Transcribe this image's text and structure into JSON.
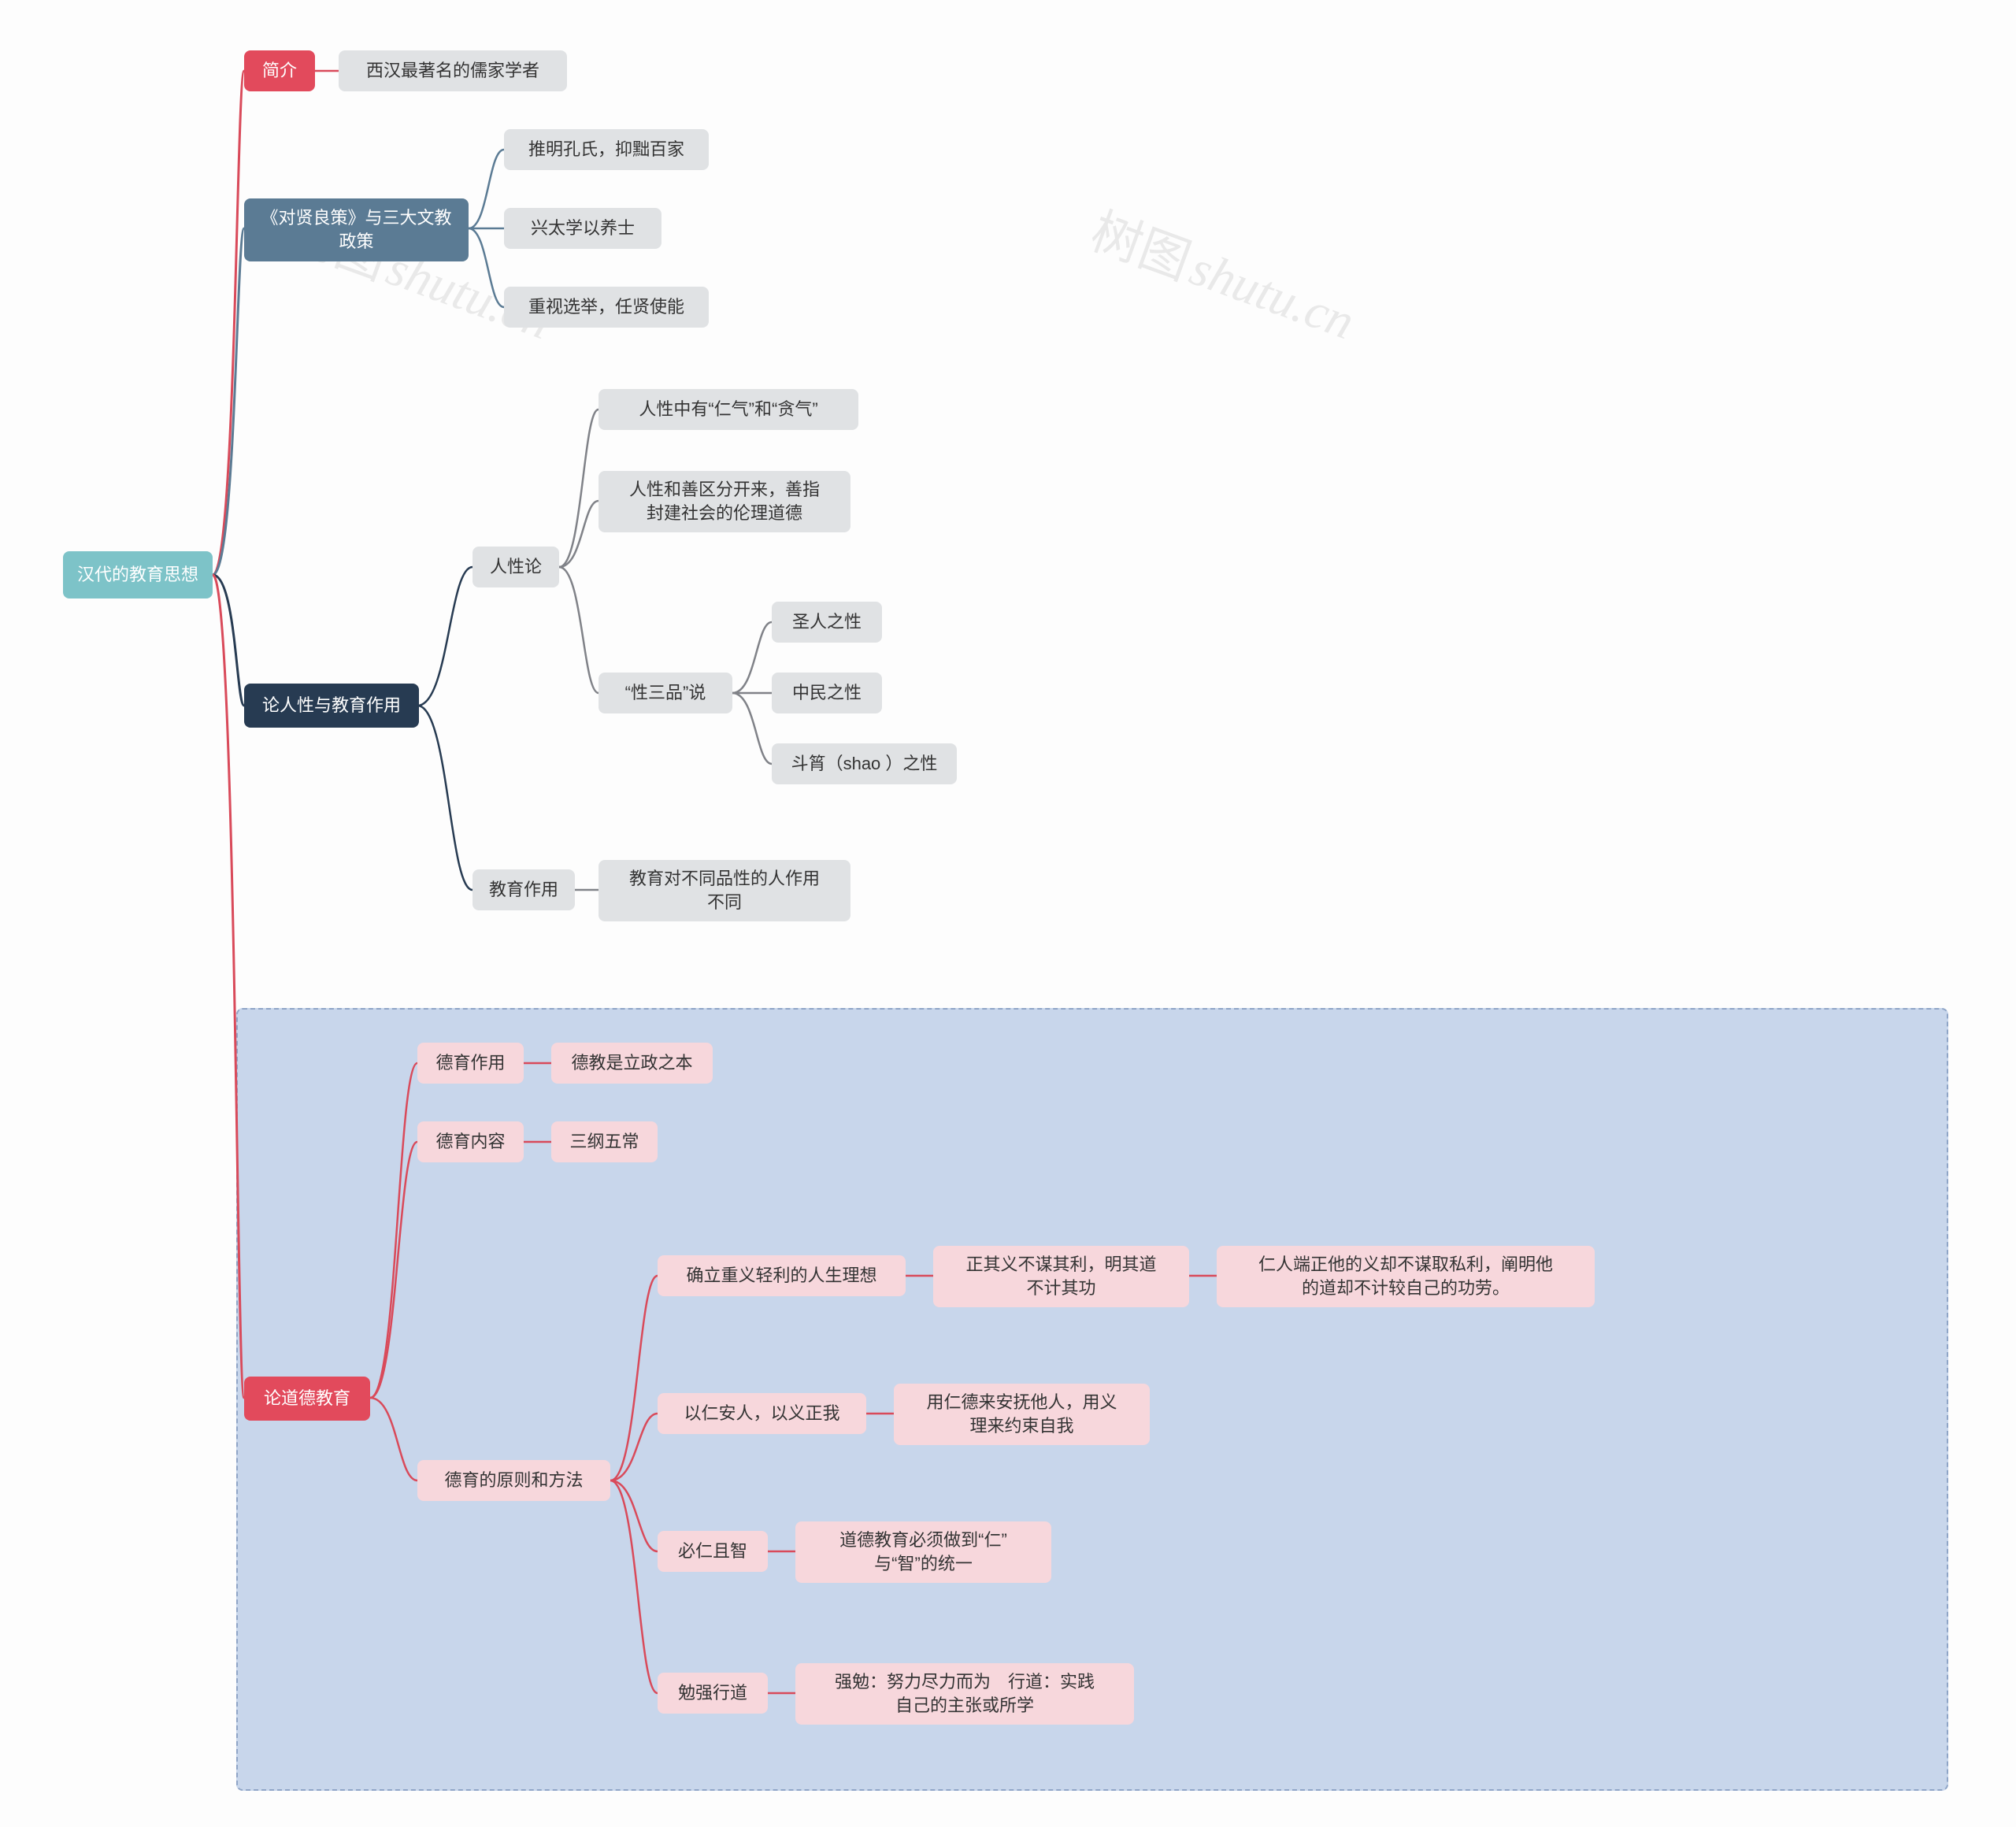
{
  "chart_data": {
    "type": "tree",
    "title": "汉代的教育思想",
    "root": {
      "id": "root",
      "label": "汉代的教育思想",
      "children": [
        {
          "id": "intro",
          "label": "简介",
          "color": "red",
          "children": [
            {
              "id": "intro_1",
              "label": "西汉最著名的儒家学者",
              "color": "gray"
            }
          ]
        },
        {
          "id": "policy",
          "label": "《对贤良策》与三大文教政策",
          "color": "steel",
          "children": [
            {
              "id": "policy_1",
              "label": "推明孔氏，抑黜百家",
              "color": "gray"
            },
            {
              "id": "policy_2",
              "label": "兴太学以养士",
              "color": "gray"
            },
            {
              "id": "policy_3",
              "label": "重视选举，任贤使能",
              "color": "gray"
            }
          ]
        },
        {
          "id": "nature",
          "label": "论人性与教育作用",
          "color": "navy",
          "children": [
            {
              "id": "nature_human",
              "label": "人性论",
              "color": "gray",
              "children": [
                {
                  "id": "nh_1",
                  "label": "人性中有“仁气”和“贪气”",
                  "color": "gray"
                },
                {
                  "id": "nh_2",
                  "label": "人性和善区分开来，善指封建社会的伦理道德",
                  "color": "gray"
                },
                {
                  "id": "nh_3",
                  "label": "“性三品”说",
                  "color": "gray",
                  "children": [
                    {
                      "id": "nh_3a",
                      "label": "圣人之性",
                      "color": "gray"
                    },
                    {
                      "id": "nh_3b",
                      "label": "中民之性",
                      "color": "gray"
                    },
                    {
                      "id": "nh_3c",
                      "label": "斗筲（shao ）之性",
                      "color": "gray"
                    }
                  ]
                }
              ]
            },
            {
              "id": "nature_edu",
              "label": "教育作用",
              "color": "gray",
              "children": [
                {
                  "id": "ne_1",
                  "label": "教育对不同品性的人作用不同",
                  "color": "gray"
                }
              ]
            }
          ]
        },
        {
          "id": "moral",
          "label": "论道德教育",
          "color": "red",
          "highlight": true,
          "children": [
            {
              "id": "m_role",
              "label": "德育作用",
              "color": "pink",
              "children": [
                {
                  "id": "m_role_1",
                  "label": "德教是立政之本",
                  "color": "pink"
                }
              ]
            },
            {
              "id": "m_content",
              "label": "德育内容",
              "color": "pink",
              "children": [
                {
                  "id": "m_content_1",
                  "label": "三纲五常",
                  "color": "pink"
                }
              ]
            },
            {
              "id": "m_method",
              "label": "德育的原则和方法",
              "color": "pink",
              "children": [
                {
                  "id": "mm_1",
                  "label": "确立重义轻利的人生理想",
                  "color": "pink",
                  "children": [
                    {
                      "id": "mm_1a",
                      "label": "正其义不谋其利，明其道不计其功",
                      "color": "pink",
                      "children": [
                        {
                          "id": "mm_1b",
                          "label": "仁人端正他的义却不谋取私利，阐明他的道却不计较自己的功劳。",
                          "color": "pink"
                        }
                      ]
                    }
                  ]
                },
                {
                  "id": "mm_2",
                  "label": "以仁安人，以义正我",
                  "color": "pink",
                  "children": [
                    {
                      "id": "mm_2a",
                      "label": "用仁德来安抚他人，用义理来约束自我",
                      "color": "pink"
                    }
                  ]
                },
                {
                  "id": "mm_3",
                  "label": "必仁且智",
                  "color": "pink",
                  "children": [
                    {
                      "id": "mm_3a",
                      "label": "道德教育必须做到“仁”与“智”的统一",
                      "color": "pink"
                    }
                  ]
                },
                {
                  "id": "mm_4",
                  "label": "勉强行道",
                  "color": "pink",
                  "children": [
                    {
                      "id": "mm_4a",
                      "label": "强勉：努力尽力而为　行道：实践自己的主张或所学",
                      "color": "pink"
                    }
                  ]
                }
              ]
            }
          ]
        }
      ]
    }
  },
  "watermark": {
    "text_han": "树图",
    "text_lat": "shutu.cn"
  },
  "nodes": {
    "root": "汉代的教育思想",
    "intro": "简介",
    "intro_1": "西汉最著名的儒家学者",
    "policy": "《对贤良策》与三大文教\n政策",
    "policy_1": "推明孔氏，抑黜百家",
    "policy_2": "兴太学以养士",
    "policy_3": "重视选举，任贤使能",
    "nature": "论人性与教育作用",
    "nature_human": "人性论",
    "nh_1": "人性中有“仁气”和“贪气”",
    "nh_2": "人性和善区分开来，善指\n封建社会的伦理道德",
    "nh_3": "“性三品”说",
    "nh_3a": "圣人之性",
    "nh_3b": "中民之性",
    "nh_3c": "斗筲（shao ）之性",
    "nature_edu": "教育作用",
    "ne_1": "教育对不同品性的人作用\n不同",
    "moral": "论道德教育",
    "m_role": "德育作用",
    "m_role_1": "德教是立政之本",
    "m_content": "德育内容",
    "m_content_1": "三纲五常",
    "m_method": "德育的原则和方法",
    "mm_1": "确立重义轻利的人生理想",
    "mm_1a": "正其义不谋其利，明其道\n不计其功",
    "mm_1b": "仁人端正他的义却不谋取私利，阐明他\n的道却不计较自己的功劳。",
    "mm_2": "以仁安人，以义正我",
    "mm_2a": "用仁德来安抚他人，用义\n理来约束自我",
    "mm_3": "必仁且智",
    "mm_3a": "道德教育必须做到“仁”\n与“智”的统一",
    "mm_4": "勉强行道",
    "mm_4a": "强勉：努力尽力而为　行道：实践\n自己的主张或所学"
  }
}
